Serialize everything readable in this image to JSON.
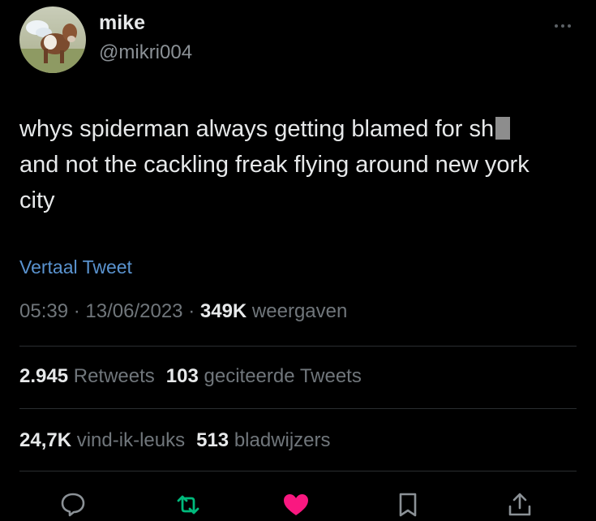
{
  "author": {
    "display_name": "mike",
    "handle": "@mikri004"
  },
  "tweet": {
    "text": "whys spiderman always getting blamed for sh",
    "text_rest": "and not the cackling freak flying around new york city",
    "translate_label": "Vertaal Tweet",
    "time": "05:39",
    "separator": "·",
    "date": "13/06/2023",
    "views_count": "349K",
    "views_label": "weergaven"
  },
  "stats": {
    "retweets_count": "2.945",
    "retweets_label": "Retweets",
    "quotes_count": "103",
    "quotes_label": "geciteerde Tweets",
    "likes_count": "24,7K",
    "likes_label": "vind-ik-leuks",
    "bookmarks_count": "513",
    "bookmarks_label": "bladwijzers"
  },
  "actions": {
    "reply_icon": "reply-icon",
    "retweet_icon": "retweet-icon",
    "like_icon": "heart-icon",
    "bookmark_icon": "bookmark-icon",
    "share_icon": "share-icon"
  },
  "colors": {
    "background": "#000000",
    "text": "#e7e9ea",
    "muted": "#70767b",
    "link": "#5a93cf",
    "retweet_green": "#00ba7c",
    "like_pink": "#f91880"
  }
}
